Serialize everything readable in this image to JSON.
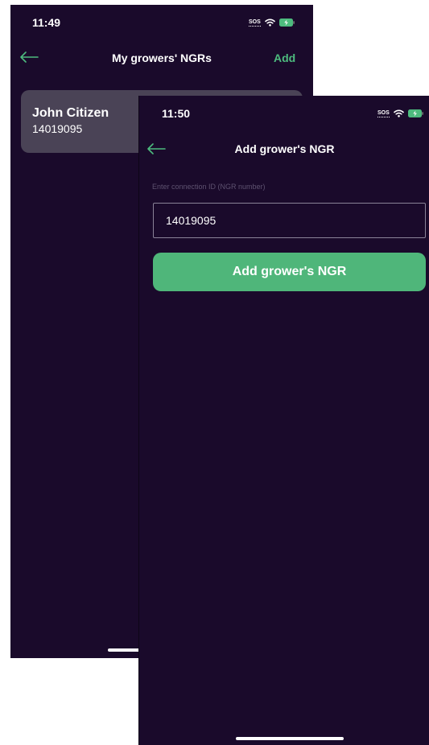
{
  "colors": {
    "background": "#1a0a2b",
    "accent_green": "#4fb67a",
    "card": "#4a4356",
    "battery_charging": "#4dbb7e"
  },
  "back_screen": {
    "status_time": "11:49",
    "status_sos": "SOS",
    "nav_title": "My growers' NGRs",
    "add_label": "Add",
    "back_icon": "arrow-left-icon",
    "growers": [
      {
        "name": "John Citizen",
        "ngr": "14019095"
      }
    ]
  },
  "front_screen": {
    "status_time": "11:50",
    "status_sos": "SOS",
    "nav_title": "Add grower's NGR",
    "back_icon": "arrow-left-icon",
    "field_label": "Enter connection ID (NGR number)",
    "ngr_value": "14019095",
    "button_label": "Add grower's NGR"
  }
}
